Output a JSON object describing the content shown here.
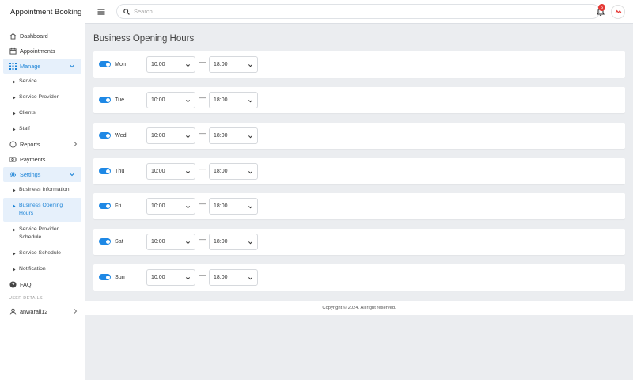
{
  "app": {
    "title": "Appointment Booking"
  },
  "sidebar": {
    "items": [
      {
        "label": "Dashboard",
        "icon": "home-icon"
      },
      {
        "label": "Appointments",
        "icon": "calendar-icon"
      },
      {
        "label": "Manage",
        "icon": "grid-icon",
        "expanded": true
      },
      {
        "label": "Reports",
        "icon": "info-circle-icon"
      },
      {
        "label": "Payments",
        "icon": "payment-icon"
      },
      {
        "label": "Settings",
        "icon": "gear-icon",
        "expanded": true
      },
      {
        "label": "FAQ",
        "icon": "help-icon"
      }
    ],
    "manage_sub": [
      "Service",
      "Service Provider",
      "Clients",
      "Staff"
    ],
    "settings_sub": [
      "Business Information",
      "Business Opening Hours",
      "Service Provider Schedule",
      "Service Schedule",
      "Notification"
    ],
    "section_user": "USER DETAILS",
    "username": "anwarali12"
  },
  "topbar": {
    "search_placeholder": "Search",
    "notification_count": "5"
  },
  "main": {
    "title": "Business Opening Hours",
    "days": [
      {
        "day": "Mon",
        "enabled": true,
        "open": "10:00",
        "close": "18:00"
      },
      {
        "day": "Tue",
        "enabled": true,
        "open": "10:00",
        "close": "18:00"
      },
      {
        "day": "Wed",
        "enabled": true,
        "open": "10:00",
        "close": "18:00"
      },
      {
        "day": "Thu",
        "enabled": true,
        "open": "10:00",
        "close": "18:00"
      },
      {
        "day": "Fri",
        "enabled": true,
        "open": "10:00",
        "close": "18:00"
      },
      {
        "day": "Sat",
        "enabled": true,
        "open": "10:00",
        "close": "18:00"
      },
      {
        "day": "Sun",
        "enabled": true,
        "open": "10:00",
        "close": "18:00"
      }
    ],
    "separator": "—"
  },
  "footer": {
    "text": "Copyright © 2024. All right reserved."
  },
  "colors": {
    "accent": "#1e88e5",
    "active_bg": "#e6f0fb",
    "badge": "#e53935"
  }
}
